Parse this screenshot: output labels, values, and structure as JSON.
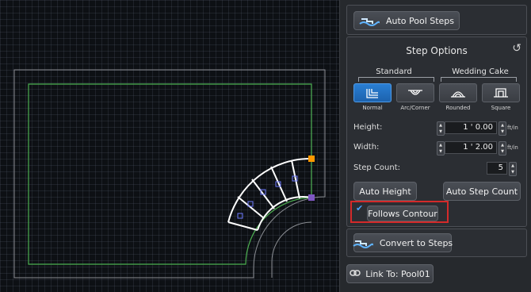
{
  "panel": {
    "auto_pool_steps": "Auto Pool Steps",
    "step_options_title": "Step Options",
    "groups": {
      "standard": "Standard",
      "wedding_cake": "Wedding Cake"
    },
    "styles": [
      {
        "name": "Normal",
        "selected": true
      },
      {
        "name": "Arc/Corner",
        "selected": false
      },
      {
        "name": "Rounded",
        "selected": false
      },
      {
        "name": "Square",
        "selected": false
      }
    ],
    "height": {
      "label": "Height:",
      "value": "1 ' 0.00",
      "unit": "ft/in"
    },
    "width": {
      "label": "Width:",
      "value": "1 ' 2.00",
      "unit": "ft/in"
    },
    "step_count": {
      "label": "Step Count:",
      "value": "5"
    },
    "auto_height": "Auto Height",
    "auto_step_count": "Auto Step Count",
    "follows_contour": {
      "label": "Follows Contour",
      "checked": true
    },
    "convert_to_steps": "Convert to Steps",
    "link_to": "Link To: Pool01"
  },
  "colors": {
    "accent": "#2a7fd4",
    "highlight": "#d42a2a",
    "pool_outline": "#4caf50",
    "handle_orange": "#ff9800",
    "handle_purple": "#7e57c2"
  }
}
